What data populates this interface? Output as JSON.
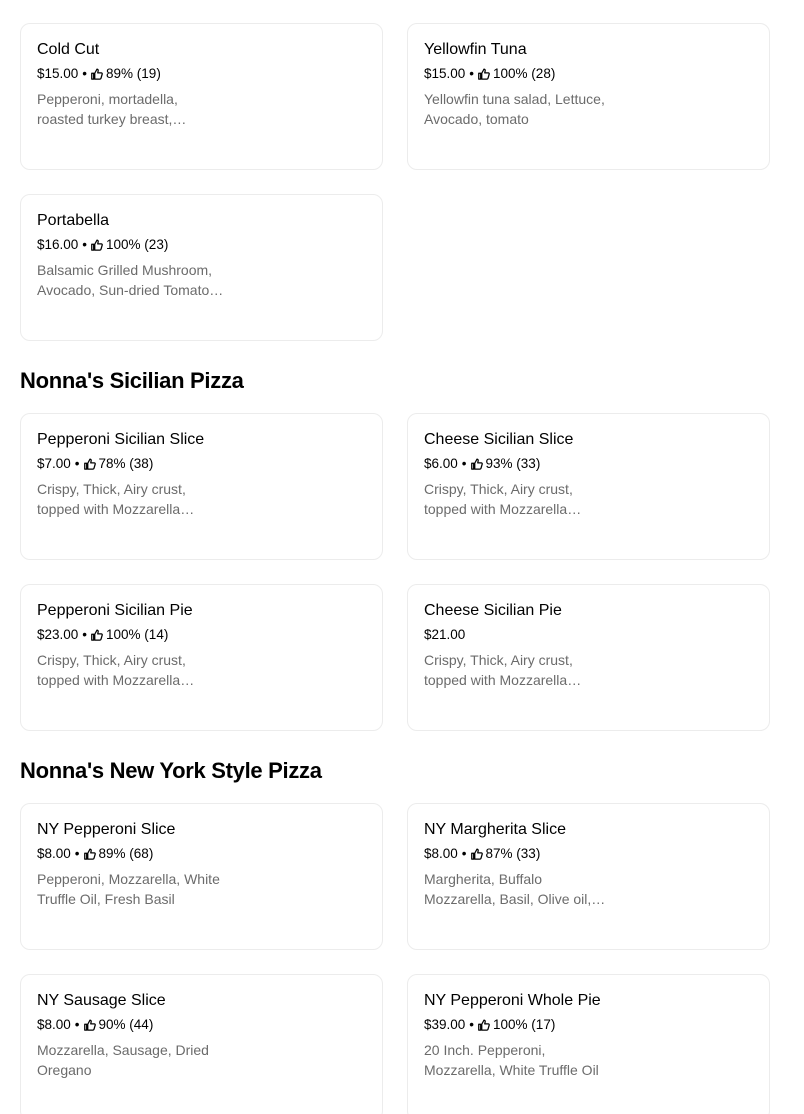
{
  "sections": [
    {
      "items": [
        {
          "name": "Cold Cut",
          "price": "$15.00",
          "rating": "89% (19)",
          "description": "Pepperoni, mortadella, roasted turkey breast, provolone"
        },
        {
          "name": "Yellowfin Tuna",
          "price": "$15.00",
          "rating": "100% (28)",
          "description": "Yellowfin tuna salad, Lettuce, Avocado, tomato"
        },
        {
          "name": "Portabella",
          "price": "$16.00",
          "rating": "100% (23)",
          "description": "Balsamic Grilled Mushroom, Avocado, Sun-dried Tomato pesto"
        }
      ]
    },
    {
      "title": "Nonna's Sicilian Pizza",
      "items": [
        {
          "name": "Pepperoni Sicilian Slice",
          "price": "$7.00",
          "rating": "78% (38)",
          "description": "Crispy, Thick, Airy crust, topped with Mozzarella cheese"
        },
        {
          "name": "Cheese Sicilian Slice",
          "price": "$6.00",
          "rating": "93% (33)",
          "description": "Crispy, Thick, Airy crust, topped with Mozzarella cheese"
        },
        {
          "name": "Pepperoni Sicilian Pie",
          "price": "$23.00",
          "rating": "100% (14)",
          "description": "Crispy, Thick, Airy crust, topped with Mozzarella cheese"
        },
        {
          "name": "Cheese Sicilian Pie",
          "price": "$21.00",
          "rating": "",
          "description": "Crispy, Thick, Airy crust, topped with Mozzarella cheese"
        }
      ]
    },
    {
      "title": "Nonna's New York Style Pizza",
      "items": [
        {
          "name": "NY Pepperoni Slice",
          "price": "$8.00",
          "rating": "89% (68)",
          "description": "Pepperoni, Mozzarella, White Truffle Oil, Fresh Basil"
        },
        {
          "name": "NY Margherita Slice",
          "price": "$8.00",
          "rating": "87% (33)",
          "description": "Margherita, Buffalo Mozzarella, Basil, Olive oil, Sauce"
        },
        {
          "name": "NY Sausage Slice",
          "price": "$8.00",
          "rating": "90% (44)",
          "description": "Mozzarella, Sausage, Dried Oregano"
        },
        {
          "name": "NY Pepperoni Whole Pie",
          "price": "$39.00",
          "rating": "100% (17)",
          "description": "20 Inch. Pepperoni, Mozzarella, White Truffle Oil"
        }
      ]
    }
  ],
  "separator": "•",
  "rating_icon": "thumbs-up-icon"
}
